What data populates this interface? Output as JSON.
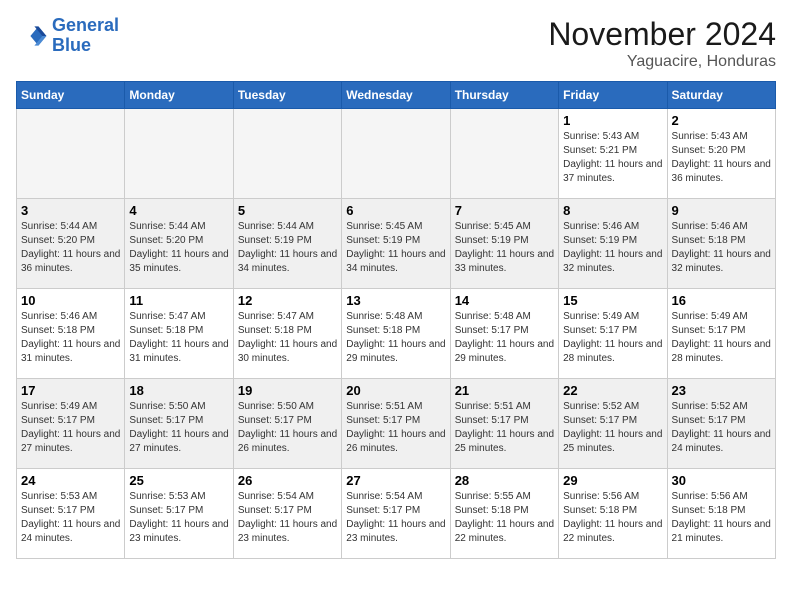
{
  "logo": {
    "line1": "General",
    "line2": "Blue"
  },
  "header": {
    "month": "November 2024",
    "location": "Yaguacire, Honduras"
  },
  "weekdays": [
    "Sunday",
    "Monday",
    "Tuesday",
    "Wednesday",
    "Thursday",
    "Friday",
    "Saturday"
  ],
  "weeks": [
    [
      {
        "day": "",
        "info": ""
      },
      {
        "day": "",
        "info": ""
      },
      {
        "day": "",
        "info": ""
      },
      {
        "day": "",
        "info": ""
      },
      {
        "day": "",
        "info": ""
      },
      {
        "day": "1",
        "info": "Sunrise: 5:43 AM\nSunset: 5:21 PM\nDaylight: 11 hours and 37 minutes."
      },
      {
        "day": "2",
        "info": "Sunrise: 5:43 AM\nSunset: 5:20 PM\nDaylight: 11 hours and 36 minutes."
      }
    ],
    [
      {
        "day": "3",
        "info": "Sunrise: 5:44 AM\nSunset: 5:20 PM\nDaylight: 11 hours and 36 minutes."
      },
      {
        "day": "4",
        "info": "Sunrise: 5:44 AM\nSunset: 5:20 PM\nDaylight: 11 hours and 35 minutes."
      },
      {
        "day": "5",
        "info": "Sunrise: 5:44 AM\nSunset: 5:19 PM\nDaylight: 11 hours and 34 minutes."
      },
      {
        "day": "6",
        "info": "Sunrise: 5:45 AM\nSunset: 5:19 PM\nDaylight: 11 hours and 34 minutes."
      },
      {
        "day": "7",
        "info": "Sunrise: 5:45 AM\nSunset: 5:19 PM\nDaylight: 11 hours and 33 minutes."
      },
      {
        "day": "8",
        "info": "Sunrise: 5:46 AM\nSunset: 5:19 PM\nDaylight: 11 hours and 32 minutes."
      },
      {
        "day": "9",
        "info": "Sunrise: 5:46 AM\nSunset: 5:18 PM\nDaylight: 11 hours and 32 minutes."
      }
    ],
    [
      {
        "day": "10",
        "info": "Sunrise: 5:46 AM\nSunset: 5:18 PM\nDaylight: 11 hours and 31 minutes."
      },
      {
        "day": "11",
        "info": "Sunrise: 5:47 AM\nSunset: 5:18 PM\nDaylight: 11 hours and 31 minutes."
      },
      {
        "day": "12",
        "info": "Sunrise: 5:47 AM\nSunset: 5:18 PM\nDaylight: 11 hours and 30 minutes."
      },
      {
        "day": "13",
        "info": "Sunrise: 5:48 AM\nSunset: 5:18 PM\nDaylight: 11 hours and 29 minutes."
      },
      {
        "day": "14",
        "info": "Sunrise: 5:48 AM\nSunset: 5:17 PM\nDaylight: 11 hours and 29 minutes."
      },
      {
        "day": "15",
        "info": "Sunrise: 5:49 AM\nSunset: 5:17 PM\nDaylight: 11 hours and 28 minutes."
      },
      {
        "day": "16",
        "info": "Sunrise: 5:49 AM\nSunset: 5:17 PM\nDaylight: 11 hours and 28 minutes."
      }
    ],
    [
      {
        "day": "17",
        "info": "Sunrise: 5:49 AM\nSunset: 5:17 PM\nDaylight: 11 hours and 27 minutes."
      },
      {
        "day": "18",
        "info": "Sunrise: 5:50 AM\nSunset: 5:17 PM\nDaylight: 11 hours and 27 minutes."
      },
      {
        "day": "19",
        "info": "Sunrise: 5:50 AM\nSunset: 5:17 PM\nDaylight: 11 hours and 26 minutes."
      },
      {
        "day": "20",
        "info": "Sunrise: 5:51 AM\nSunset: 5:17 PM\nDaylight: 11 hours and 26 minutes."
      },
      {
        "day": "21",
        "info": "Sunrise: 5:51 AM\nSunset: 5:17 PM\nDaylight: 11 hours and 25 minutes."
      },
      {
        "day": "22",
        "info": "Sunrise: 5:52 AM\nSunset: 5:17 PM\nDaylight: 11 hours and 25 minutes."
      },
      {
        "day": "23",
        "info": "Sunrise: 5:52 AM\nSunset: 5:17 PM\nDaylight: 11 hours and 24 minutes."
      }
    ],
    [
      {
        "day": "24",
        "info": "Sunrise: 5:53 AM\nSunset: 5:17 PM\nDaylight: 11 hours and 24 minutes."
      },
      {
        "day": "25",
        "info": "Sunrise: 5:53 AM\nSunset: 5:17 PM\nDaylight: 11 hours and 23 minutes."
      },
      {
        "day": "26",
        "info": "Sunrise: 5:54 AM\nSunset: 5:17 PM\nDaylight: 11 hours and 23 minutes."
      },
      {
        "day": "27",
        "info": "Sunrise: 5:54 AM\nSunset: 5:17 PM\nDaylight: 11 hours and 23 minutes."
      },
      {
        "day": "28",
        "info": "Sunrise: 5:55 AM\nSunset: 5:18 PM\nDaylight: 11 hours and 22 minutes."
      },
      {
        "day": "29",
        "info": "Sunrise: 5:56 AM\nSunset: 5:18 PM\nDaylight: 11 hours and 22 minutes."
      },
      {
        "day": "30",
        "info": "Sunrise: 5:56 AM\nSunset: 5:18 PM\nDaylight: 11 hours and 21 minutes."
      }
    ]
  ]
}
